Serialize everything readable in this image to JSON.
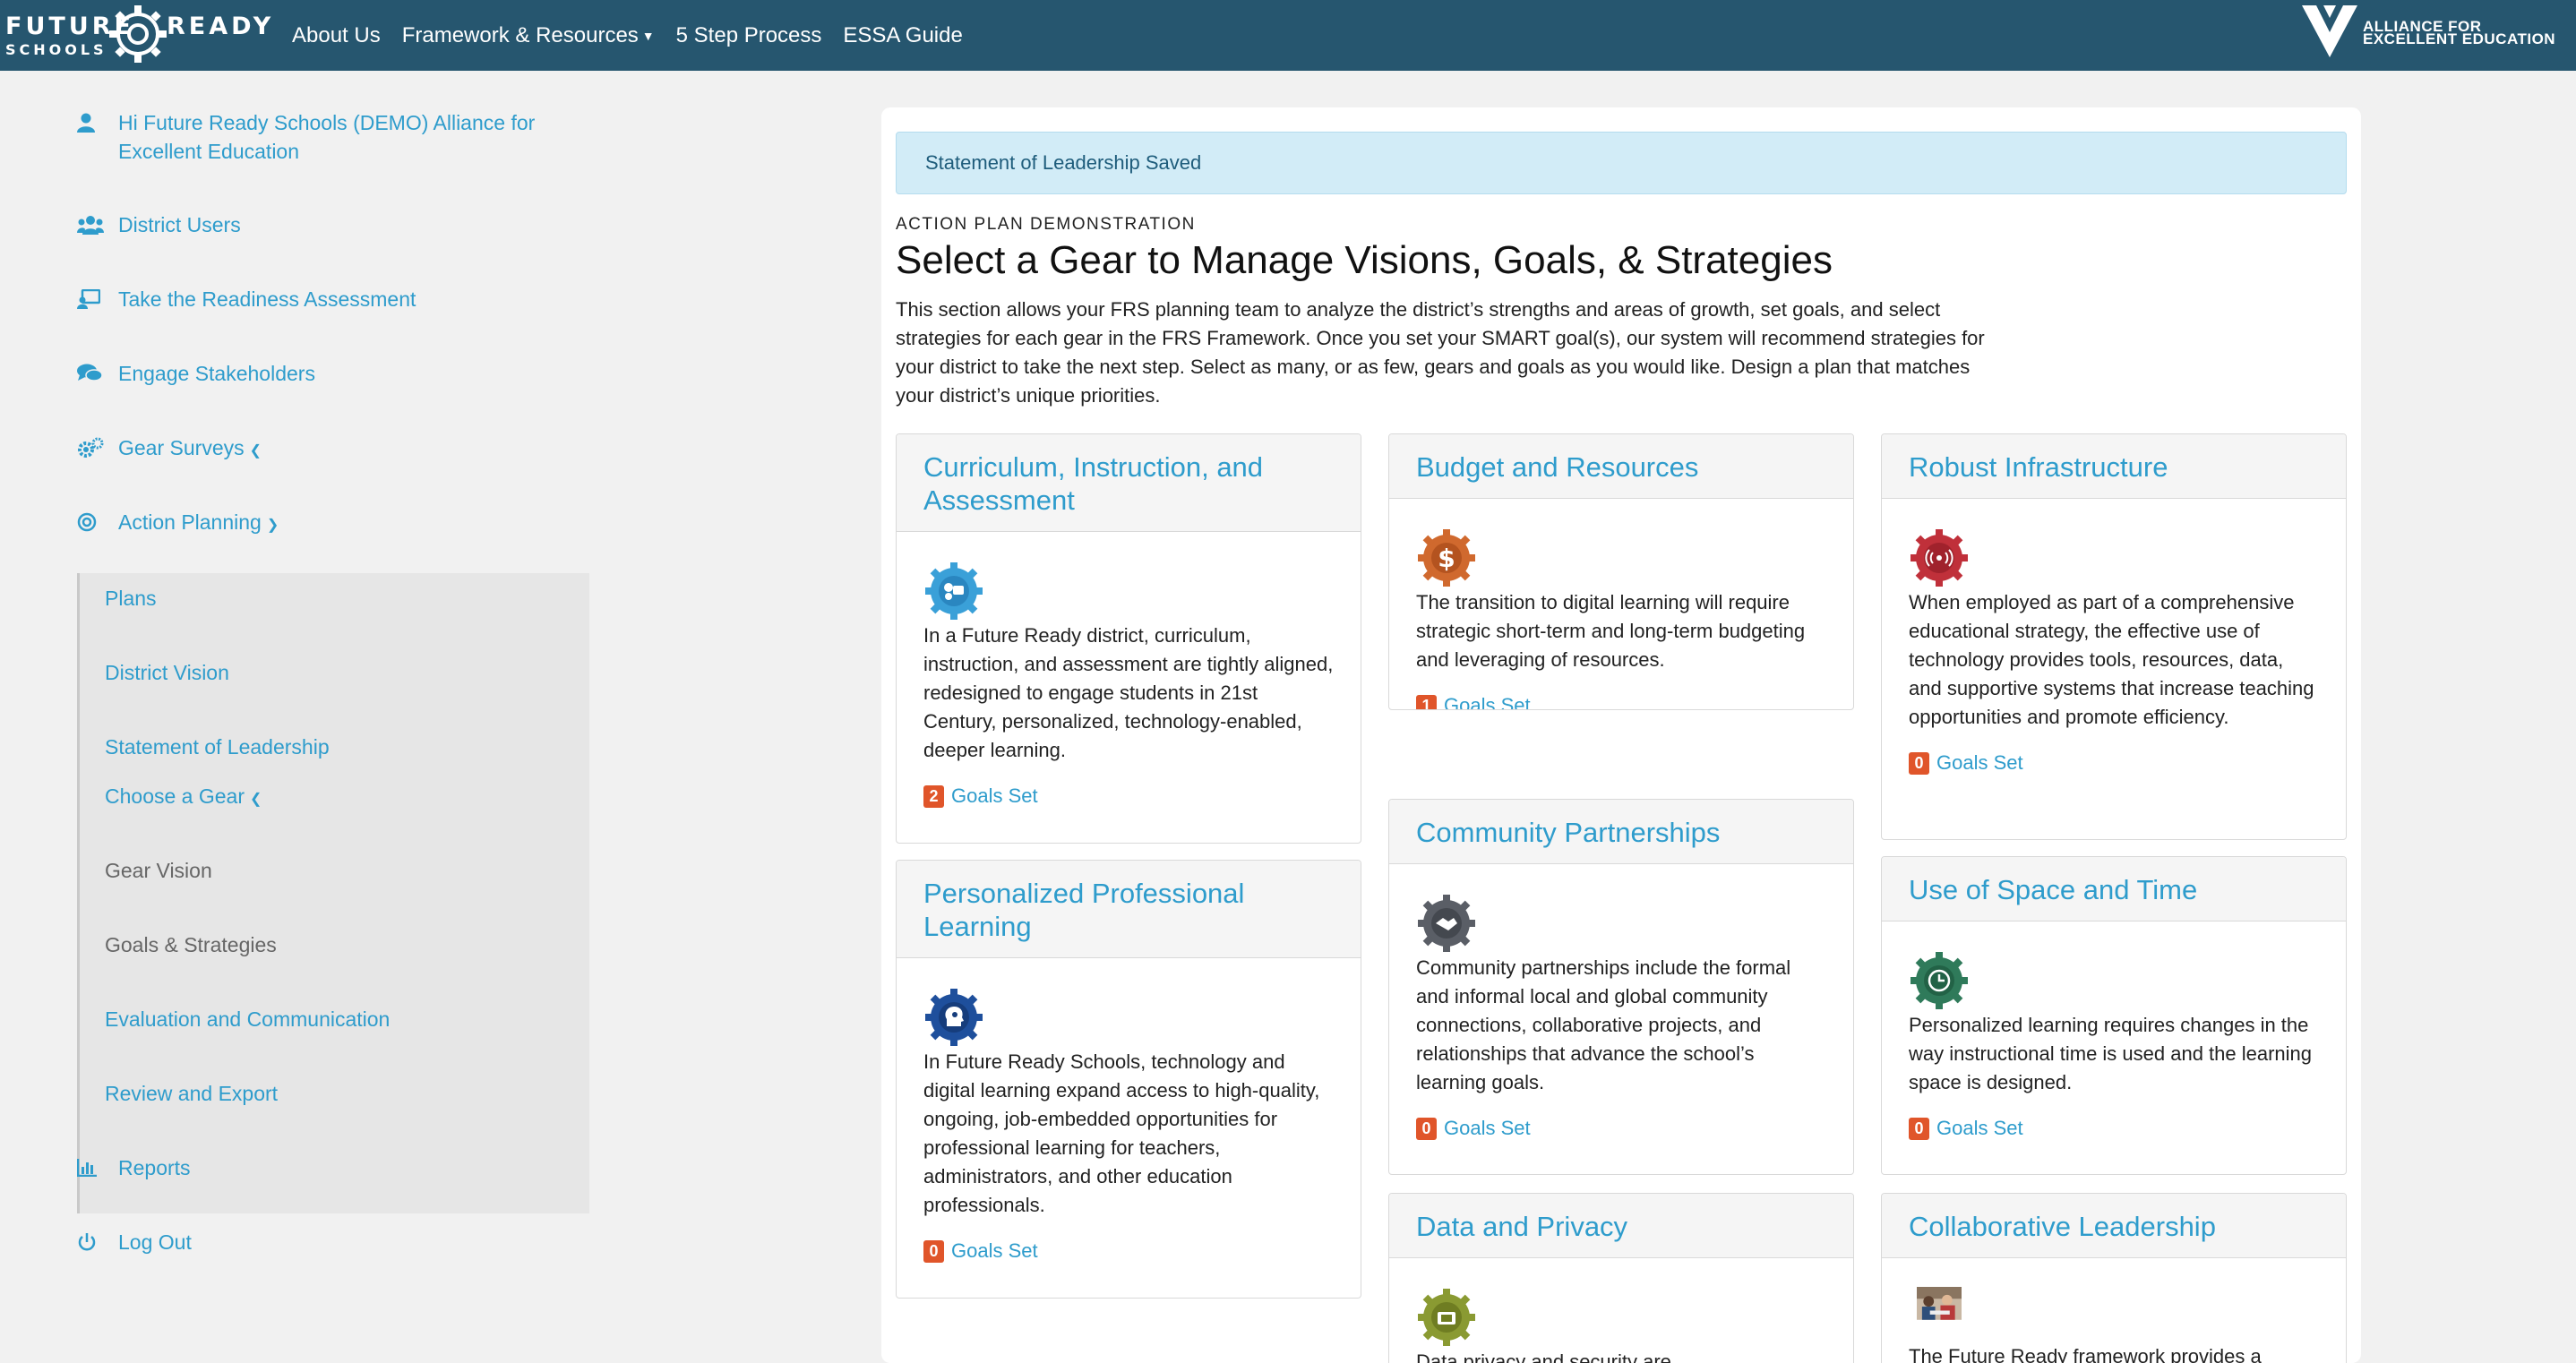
{
  "header": {
    "logo": {
      "word1": "FUTURE",
      "word2": "READY",
      "word3": "SCHOOLS"
    },
    "nav": [
      {
        "label": "About Us",
        "has_caret": false
      },
      {
        "label": "Framework & Resources",
        "has_caret": true
      },
      {
        "label": "5 Step Process",
        "has_caret": false
      },
      {
        "label": "ESSA Guide",
        "has_caret": false
      }
    ],
    "partner": {
      "line1": "ALLIANCE FOR",
      "line2": "EXCELLENT EDUCATION"
    }
  },
  "sidebar": {
    "greeting": "Hi Future Ready Schools (DEMO) Alliance for Excellent Education",
    "items": [
      {
        "label": "District Users",
        "icon": "users-icon"
      },
      {
        "label": "Take the Readiness Assessment",
        "icon": "assessment-icon"
      },
      {
        "label": "Engage Stakeholders",
        "icon": "comments-icon"
      },
      {
        "label": "Gear Surveys",
        "icon": "cogs-icon"
      },
      {
        "label": "Action Planning",
        "icon": "target-icon"
      }
    ],
    "action_planning_sub": [
      {
        "label": "Plans"
      },
      {
        "label": "District Vision"
      },
      {
        "label": "Statement of Leadership"
      },
      {
        "label": "Choose a Gear"
      },
      {
        "label": "Gear Vision"
      },
      {
        "label": "Goals & Strategies"
      },
      {
        "label": "Evaluation and Communication"
      },
      {
        "label": "Review and Export"
      }
    ],
    "bottom_items": [
      {
        "label": "Reports",
        "icon": "chart-icon"
      },
      {
        "label": "Log Out",
        "icon": "power-icon"
      }
    ]
  },
  "main": {
    "alert": "Statement of Leadership Saved",
    "eyebrow": "ACTION PLAN DEMONSTRATION",
    "title": "Select a Gear to Manage Visions, Goals, & Strategies",
    "intro": "This section allows your FRS planning team to analyze the district’s strengths and areas of growth, set goals, and select strategies for each gear in the FRS Framework. Once you set your SMART goal(s), our system will recommend strategies for your district to take the next step. Select as many, or as few, gears and goals as you would like. Design a plan that matches your district’s unique priorities.",
    "goals_label": "Goals Set",
    "cards": [
      {
        "title": "Curriculum, Instruction, and Assessment",
        "text": "In a Future Ready district, curriculum, instruction, and assessment are tightly aligned, redesigned to engage students in 21st Century, personalized, technology-enabled, deeper learning.",
        "goals": "2",
        "icon": "curriculum-gear-icon",
        "color": "#3aa0d8"
      },
      {
        "title": "Budget and Resources",
        "text": "The transition to digital learning will require strategic short-term and long-term budgeting and leveraging of resources.",
        "goals": "1",
        "icon": "budget-gear-icon",
        "color": "#d0692e"
      },
      {
        "title": "Robust Infrastructure",
        "text": "When employed as part of a comprehensive educational strategy, the effective use of technology provides tools, resources, data, and supportive systems that increase teaching opportunities and promote efficiency.",
        "goals": "0",
        "icon": "infrastructure-gear-icon",
        "color": "#c0303a"
      },
      {
        "title": "Personalized Professional Learning",
        "text": "In Future Ready Schools, technology and digital learning expand access to high-quality, ongoing, job-embedded opportunities for professional learning for teachers, administrators, and other education professionals.",
        "goals": "0",
        "icon": "professional-learning-gear-icon",
        "color": "#1e4f9c"
      },
      {
        "title": "Community Partnerships",
        "text": "Community partnerships include the formal and informal local and global community connections, collaborative projects, and relationships that advance the school’s learning goals.",
        "goals": "0",
        "icon": "community-gear-icon",
        "color": "#5a5e66"
      },
      {
        "title": "Use of Space and Time",
        "text": "Personalized learning requires changes in the way instructional time is used and the learning space is designed.",
        "goals": "0",
        "icon": "clock-gear-icon",
        "color": "#2f7a5a"
      },
      {
        "title": "Data and Privacy",
        "text": "Data privacy and security are",
        "icon": "data-gear-icon",
        "color": "#8a9a32"
      },
      {
        "title": "Collaborative Leadership",
        "text": "The Future Ready framework provides a",
        "icon": "leadership-photo"
      }
    ]
  }
}
